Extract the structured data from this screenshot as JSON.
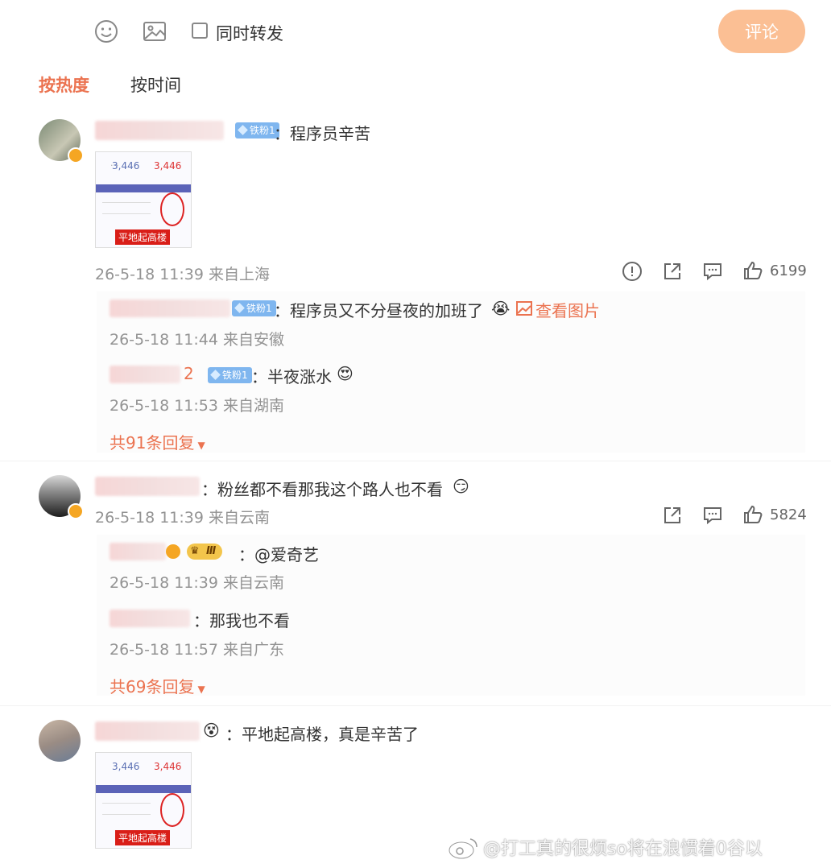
{
  "composer": {
    "repost_label": "同时转发",
    "submit_label": "评论",
    "emoji_icon": "smiley-icon",
    "image_icon": "image-icon"
  },
  "sort_tabs": [
    {
      "label": "按热度",
      "active": true
    },
    {
      "label": "按时间",
      "active": false
    }
  ],
  "colors": {
    "accent": "#eb7350",
    "submit_bg": "#fbbf94",
    "fan_badge": "#7fb6ef"
  },
  "comments": [
    {
      "badge": "铁粉1",
      "text": "：程序员辛苦",
      "image_caption": "平地起高楼",
      "image_values": [
        "3,446",
        "3,446"
      ],
      "meta": "26-5-18 11:39 来自上海",
      "likes": "6199",
      "replies": [
        {
          "badge": "铁粉1",
          "text": "：程序员又不分昼夜的加班了",
          "link": "查看图片",
          "meta": "26-5-18 11:44 来自安徽"
        },
        {
          "name_suffix": "2",
          "badge": "铁粉1",
          "text": "：半夜涨水",
          "meta": "26-5-18 11:53 来自湖南"
        }
      ],
      "more_replies": "共91条回复"
    },
    {
      "text": "：粉丝都不看那我这个路人也不看",
      "meta": "26-5-18 11:39 来自云南",
      "likes": "5824",
      "replies": [
        {
          "badge": "Ⅲ",
          "text": "：@爱奇艺",
          "meta": "26-5-18 11:39 来自云南"
        },
        {
          "text": "：那我也不看",
          "meta": "26-5-18 11:57 来自广东"
        }
      ],
      "more_replies": "共69条回复"
    },
    {
      "text": "：平地起高楼，真是辛苦了",
      "image_caption": "平地起高楼",
      "image_values": [
        "3,446",
        "3,446"
      ]
    }
  ],
  "watermark": "@打工真的很烦so将在浪惯着0谷以"
}
